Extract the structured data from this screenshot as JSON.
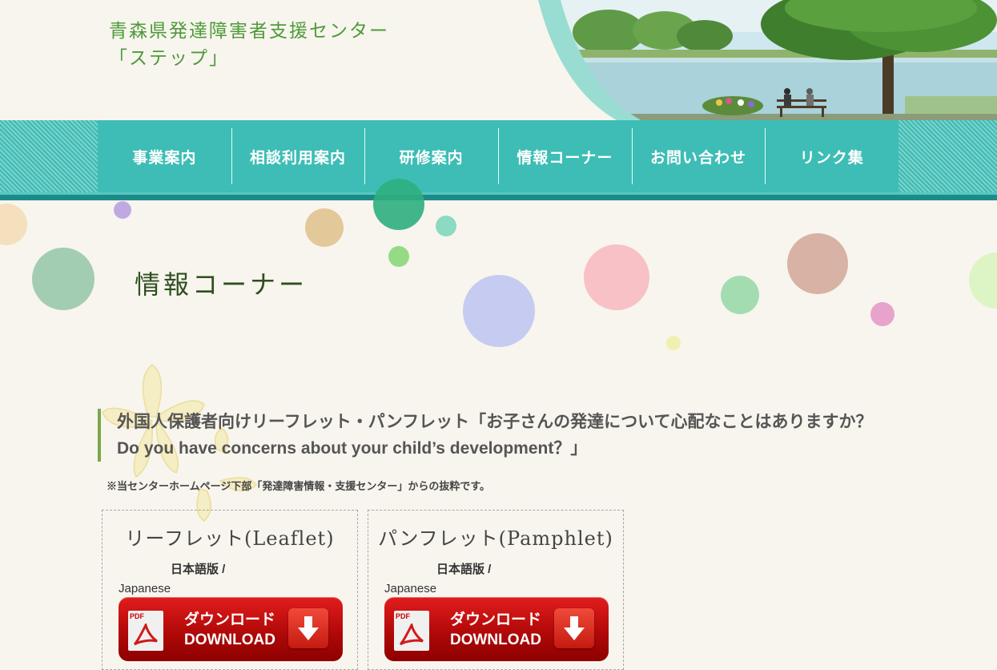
{
  "header": {
    "title_line1": "青森県発達障害者支援センター",
    "title_line2": "「ステップ」"
  },
  "nav": [
    {
      "label": "事業案内"
    },
    {
      "label": "相談利用案内"
    },
    {
      "label": "研修案内"
    },
    {
      "label": "情報コーナー"
    },
    {
      "label": "お問い合わせ"
    },
    {
      "label": "リンク集"
    }
  ],
  "page_title": "情報コーナー",
  "article": {
    "heading_jp": "外国人保護者向けリーフレット・パンフレット「お子さんの発達について心配なことはありますか？",
    "heading_en": "Do you have concerns about your child’s development？」",
    "note": "※当センターホームページ下部「発達障害情報・支援センター」からの抜粋です。"
  },
  "cards": [
    {
      "title": "リーフレット(Leaflet)",
      "lang_jp": "日本語版 /",
      "lang_en": "Japanese",
      "download_jp": "ダウンロード",
      "download_en": "DOWNLOAD",
      "pdf_label": "PDF"
    },
    {
      "title": "パンフレット(Pamphlet)",
      "lang_jp": "日本語版 /",
      "lang_en": "Japanese",
      "download_jp": "ダウンロード",
      "download_en": "DOWNLOAD",
      "pdf_label": "PDF"
    }
  ],
  "icons": {
    "pdf": "pdf-file-icon",
    "download": "download-arrow-icon"
  },
  "colors": {
    "nav_bg": "#3dbdb5",
    "title_green": "#4e9a3a",
    "button_red": "#c40f0f"
  }
}
